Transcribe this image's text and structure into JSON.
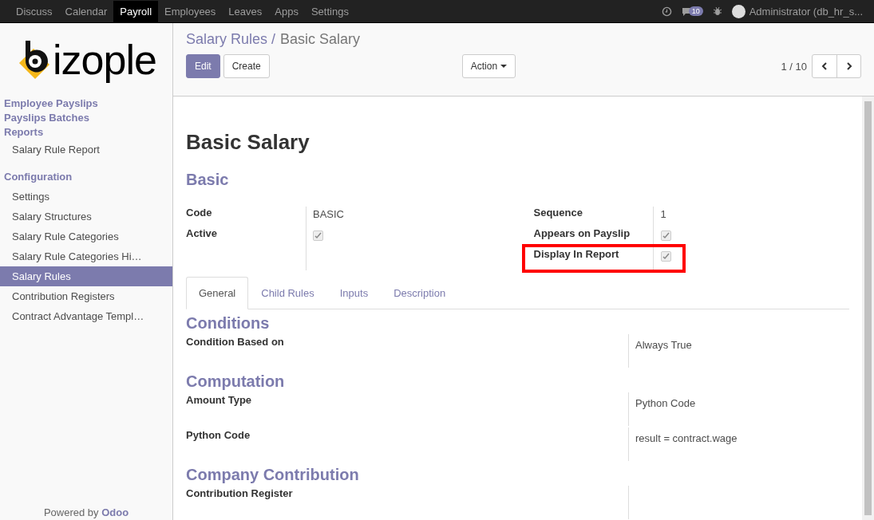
{
  "top_menu": [
    {
      "label": "Discuss",
      "selected": false
    },
    {
      "label": "Calendar",
      "selected": false
    },
    {
      "label": "Payroll",
      "selected": true
    },
    {
      "label": "Employees",
      "selected": false
    },
    {
      "label": "Leaves",
      "selected": false
    },
    {
      "label": "Apps",
      "selected": false
    },
    {
      "label": "Settings",
      "selected": false
    }
  ],
  "systray": {
    "message_count": "10",
    "user": "Administrator (db_hr_s..."
  },
  "logo": {
    "text": "izople"
  },
  "sidebar": {
    "items": [
      {
        "kind": "header",
        "label": "Employee Payslips",
        "selected": false
      },
      {
        "kind": "header",
        "label": "Payslips Batches",
        "selected": false
      },
      {
        "kind": "header",
        "label": "Reports",
        "selected": false
      },
      {
        "kind": "item",
        "label": "Salary Rule Report",
        "selected": false
      },
      {
        "kind": "section",
        "label": "Configuration",
        "selected": false
      },
      {
        "kind": "item",
        "label": "Settings",
        "selected": false
      },
      {
        "kind": "item",
        "label": "Salary Structures",
        "selected": false
      },
      {
        "kind": "item",
        "label": "Salary Rule Categories",
        "selected": false
      },
      {
        "kind": "item",
        "label": "Salary Rule Categories Hi…",
        "selected": false
      },
      {
        "kind": "item",
        "label": "Salary Rules",
        "selected": true
      },
      {
        "kind": "item",
        "label": "Contribution Registers",
        "selected": false
      },
      {
        "kind": "item",
        "label": "Contract Advantage Templ…",
        "selected": false
      }
    ],
    "footer": {
      "text": "Powered by",
      "link": "Odoo"
    }
  },
  "breadcrumb": {
    "parent": "Salary Rules /",
    "current": "Basic Salary"
  },
  "buttons": {
    "edit": "Edit",
    "create": "Create",
    "action": "Action"
  },
  "pager": "1 / 10",
  "form": {
    "title": "Basic Salary",
    "subtitle": "Basic",
    "left_fields": [
      {
        "kind": "text",
        "label": "Code",
        "value": "BASIC",
        "highlighted": false
      },
      {
        "kind": "checkbox",
        "label": "Active",
        "checked": true,
        "highlighted": false
      }
    ],
    "right_fields": [
      {
        "kind": "text",
        "label": "Sequence",
        "value": "1",
        "highlighted": false
      },
      {
        "kind": "checkbox",
        "label": "Appears on Payslip",
        "checked": true,
        "highlighted": false
      },
      {
        "kind": "checkbox",
        "label": "Display In Report",
        "checked": true,
        "highlighted": true
      }
    ],
    "tabs": [
      {
        "label": "General",
        "selected": true
      },
      {
        "label": "Child Rules",
        "selected": false
      },
      {
        "label": "Inputs",
        "selected": false
      },
      {
        "label": "Description",
        "selected": false
      }
    ],
    "sections": [
      {
        "title": "Conditions",
        "fields": [
          {
            "label": "Condition Based on",
            "value": "Always True"
          }
        ]
      },
      {
        "title": "Computation",
        "fields": [
          {
            "label": "Amount Type",
            "value": "Python Code"
          },
          {
            "label": "Python Code",
            "value": "result = contract.wage"
          }
        ]
      },
      {
        "title": "Company Contribution",
        "fields": [
          {
            "label": "Contribution Register"
          }
        ]
      }
    ]
  }
}
